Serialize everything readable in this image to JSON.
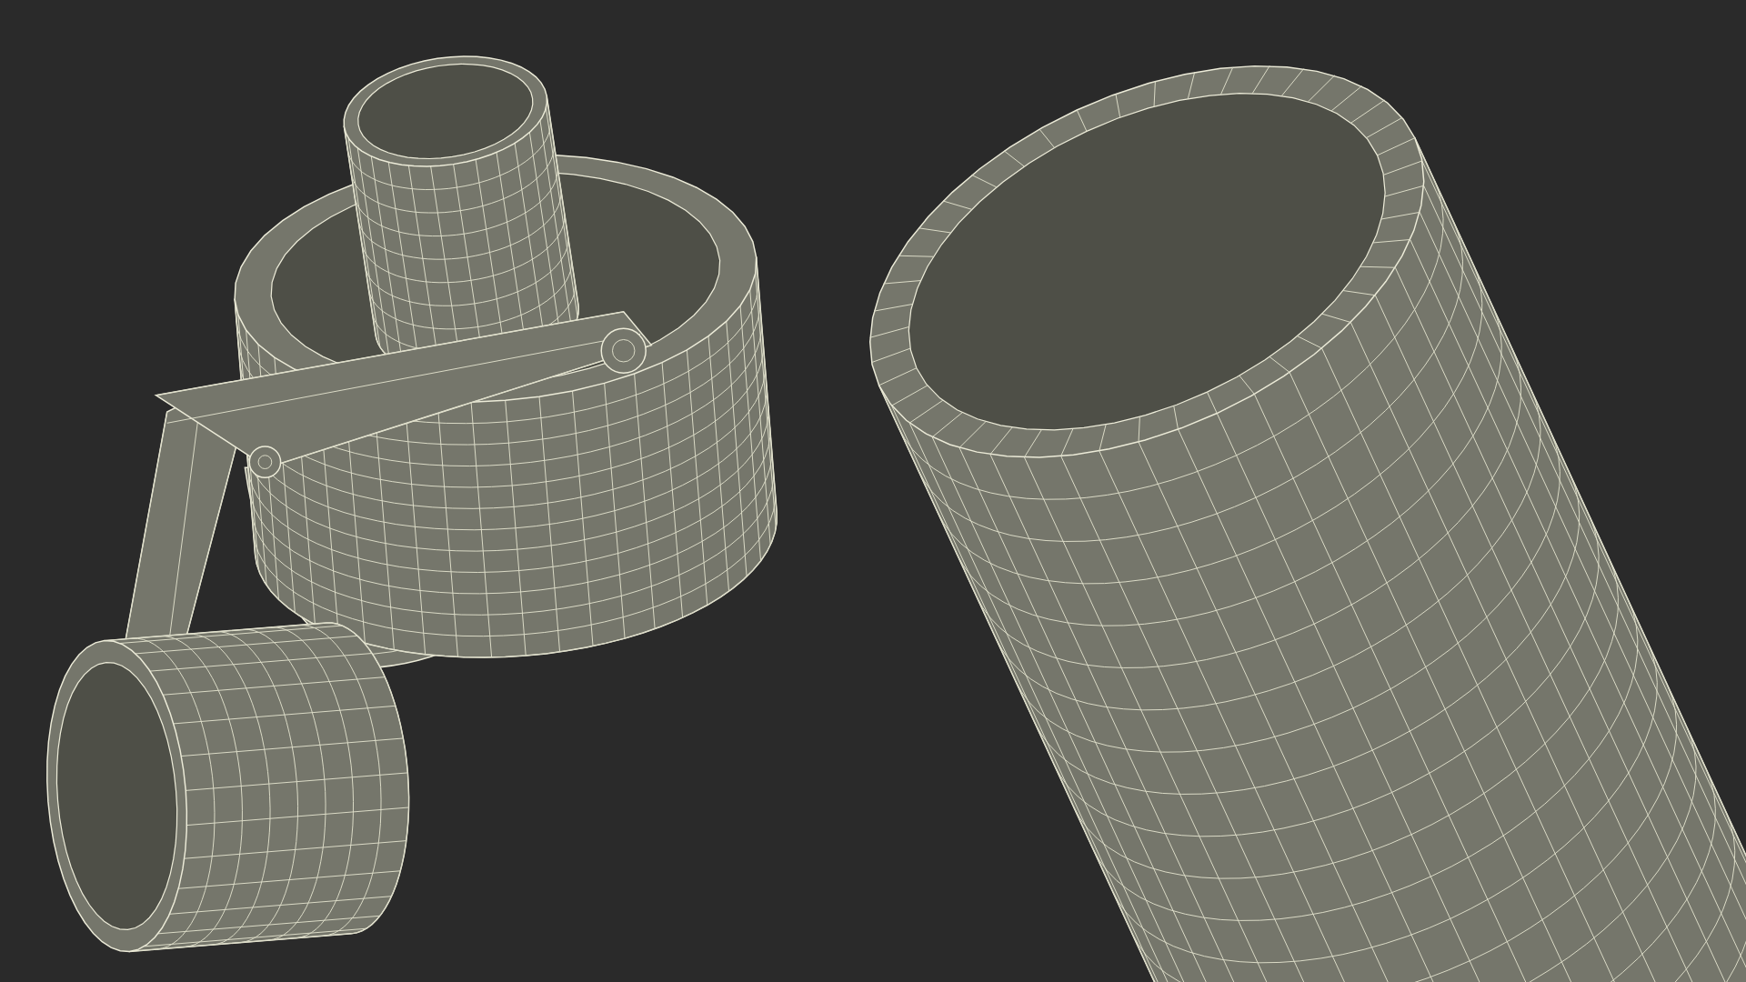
{
  "viewport": {
    "kind": "wireframe-render"
  }
}
